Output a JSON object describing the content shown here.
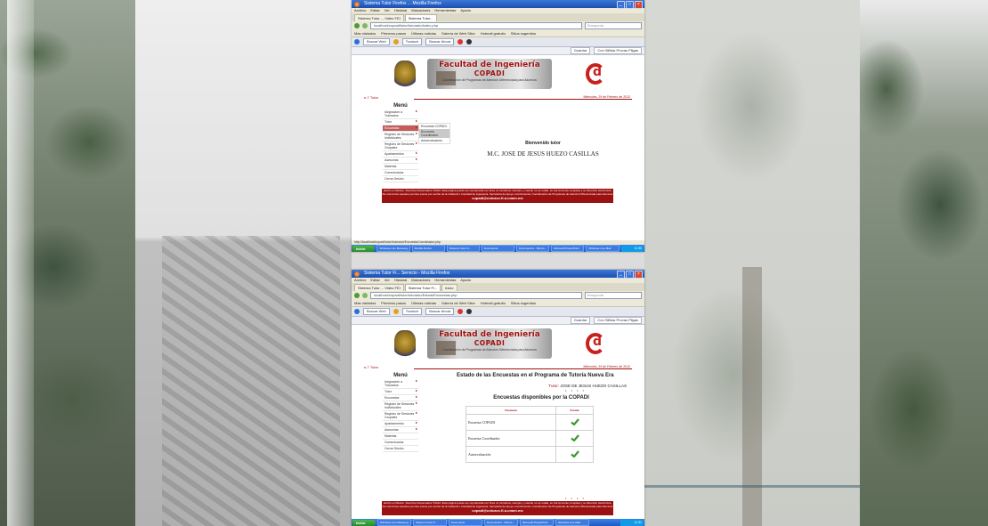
{
  "shot1": {
    "window_title": "Sistema Tutor Firefox ... Mozilla Firefox",
    "window_buttons": [
      "_",
      "□",
      "×"
    ],
    "menu": [
      "Archivo",
      "Editar",
      "Ver",
      "Historial",
      "Marcadores",
      "Herramientas",
      "Ayuda"
    ],
    "tabs": [
      "Sistema Tutor ... Video FEI",
      "Sistema Tutor..."
    ],
    "url": "localhost/copadi/tutor/tutorado/index.php",
    "search_placeholder": "Búsqueda",
    "bookmarks": [
      "Más visitados",
      "Primeros pasos",
      "Últimas noticias",
      "Galería de Web Slice",
      "Hotmail gratuito",
      "Sitios sugeridos"
    ],
    "toolbar": {
      "search_box": "Buscar Web",
      "traducir": "Traducir",
      "buscar": "Buscar Ahora"
    },
    "toolbar2": [
      "Guardar",
      "Con Sillitas Provas Pllgas"
    ],
    "subhead_left": "e-7 Tutor",
    "subhead_right": "Miércoles, 29 de Febrero de 2012",
    "menu_title": "Menú",
    "menu_items": [
      {
        "label": "Asignación a Tutorados",
        "arrow": true
      },
      {
        "label": "Tutor",
        "arrow": true
      },
      {
        "label": "Encuestas",
        "arrow": true,
        "highlight": true
      },
      {
        "label": "Registro de Sesiones Individuales",
        "arrow": true
      },
      {
        "label": "Registro de Sesiones Grupales",
        "arrow": true
      },
      {
        "label": "Apartamentos",
        "arrow": true
      },
      {
        "label": "Asesorías",
        "arrow": true
      },
      {
        "label": "Materias",
        "arrow": false
      },
      {
        "label": "Comunicados",
        "arrow": false
      },
      {
        "label": "Cerrar Sesión",
        "arrow": false
      }
    ],
    "submenu": [
      {
        "label": "Encuesta COPADI",
        "highlight": false
      },
      {
        "label": "Encuesta Coordinador",
        "highlight": true
      },
      {
        "label": "Autoevaluación",
        "highlight": false
      }
    ],
    "welcome": "Bienvenido tutor",
    "tutor_name": "M.C. JOSE DE JESUS HUEZO CASILLAS",
    "footer_text": "Hecho en México. Derechos Reservados ©2012. Esta página puede ser reproducida con fines no lucrativos, siempre y cuando no se mutile, se cite la fuente completa y su dirección electrónica. De otra forma requiere permiso previo por escrito de la institución. Facultad de Ingeniería, Secretaría de Apoyo a la Docencia, Coordinación de Programas de Atención Diferenciada para Alumnos",
    "footer_email": "copadi@unicacc.fi-a.unam.mx",
    "statusbar": "http://localhost/copadi/tutor/tutorado/EncuestaCoordinador.php",
    "taskbar": {
      "start": "Inicio",
      "items": [
        "Windows Live Messeng...",
        "Mozilla Firefox",
        "Sistema Tutor Fi...",
        "Documento",
        "Documento1 - Micros...",
        "Microsoft PowerPoint",
        "Windows Live Mail"
      ],
      "clock": "11:30"
    }
  },
  "shot2": {
    "window_title": "Sistema Tutor Fi... Servicio - Mozilla Firefox",
    "window_buttons": [
      "_",
      "□",
      "×"
    ],
    "menu": [
      "Archivo",
      "Editar",
      "Ver",
      "Historial",
      "Marcadores",
      "Herramientas",
      "Ayuda"
    ],
    "tabs": [
      "Sistema Tutor ... Video FEI",
      "Sistema Tutor Fi...",
      "Inicio"
    ],
    "url": "localhost/copadi/tutor/tutorado/EstadoEncuestas.php",
    "search_placeholder": "Búsqueda",
    "bookmarks": [
      "Más visitados",
      "Primeros pasos",
      "Últimas noticias",
      "Galería de Web Slice",
      "Hotmail gratuito",
      "Sitios sugeridos"
    ],
    "toolbar": {
      "search_box": "Buscar Web",
      "traducir": "Traducir",
      "buscar": "Buscar Ahora"
    },
    "toolbar2": [
      "Guardar",
      "Con Sillitas Provas Pllgas"
    ],
    "subhead_left": "e-7 Tutor",
    "subhead_right": "Miércoles, 29 de Febrero de 2012",
    "menu_title": "Menú",
    "menu_items": [
      {
        "label": "Asignación a Tutorados",
        "arrow": true
      },
      {
        "label": "Tutor",
        "arrow": true
      },
      {
        "label": "Encuestas",
        "arrow": true
      },
      {
        "label": "Registro de Sesiones Individuales",
        "arrow": true
      },
      {
        "label": "Registro de Sesiones Grupales",
        "arrow": true
      },
      {
        "label": "Apartamentos",
        "arrow": true
      },
      {
        "label": "Asesorías",
        "arrow": true
      },
      {
        "label": "Materias",
        "arrow": false
      },
      {
        "label": "Comunicados",
        "arrow": false
      },
      {
        "label": "Cerrar Sesión",
        "arrow": false
      }
    ],
    "estado_title": "Estado de las Encuestas en el Programa de Tutoría Nueva Era",
    "tutor_label": "Tutor:",
    "tutor_name": "JOSE DE JESUS HUEZO CASILLAS",
    "dots": "• • • •",
    "disp_title": "Encuestas disponibles por la COPADI",
    "table_headers": [
      "Encuesta",
      "Estado"
    ],
    "table_rows": [
      {
        "name": "Encuesta COPADI",
        "status": "check-icon"
      },
      {
        "name": "Encuesta Coordinador",
        "status": "check-icon"
      },
      {
        "name": "Autoevaluación",
        "status": "check-icon"
      }
    ],
    "footer_text": "Hecho en México. Derechos Reservados ©2012. Esta página puede ser reproducida con fines no lucrativos, siempre y cuando no se mutile, se cite la fuente completa y su dirección electrónica. De otra forma requiere permiso previo por escrito de la institución. Facultad de Ingeniería, Secretaría de Apoyo a la Docencia, Coordinación de Programas de Atención Diferenciada para Alumnos",
    "footer_email": "copadi@unicacc.fi-a.unam.mx",
    "taskbar": {
      "start": "Inicio",
      "items": [
        "Windows Live Messeng...",
        "Sistema Tutor Fi...",
        "Documento",
        "Documento1 - Micros...",
        "Microsoft PowerPoint",
        "Windows Live Mail"
      ],
      "clock": "11:31"
    }
  },
  "banner": {
    "line1": "Facultad de Ingeniería",
    "line2": "COPADI",
    "line3": "Coordinación de Programas de Atención Diferenciada para Alumnos"
  },
  "colors": {
    "brand_red": "#a01010",
    "footer_red": "#9b1010",
    "check_green": "#3a9a2a",
    "xp_blue": "#1f57c7"
  }
}
